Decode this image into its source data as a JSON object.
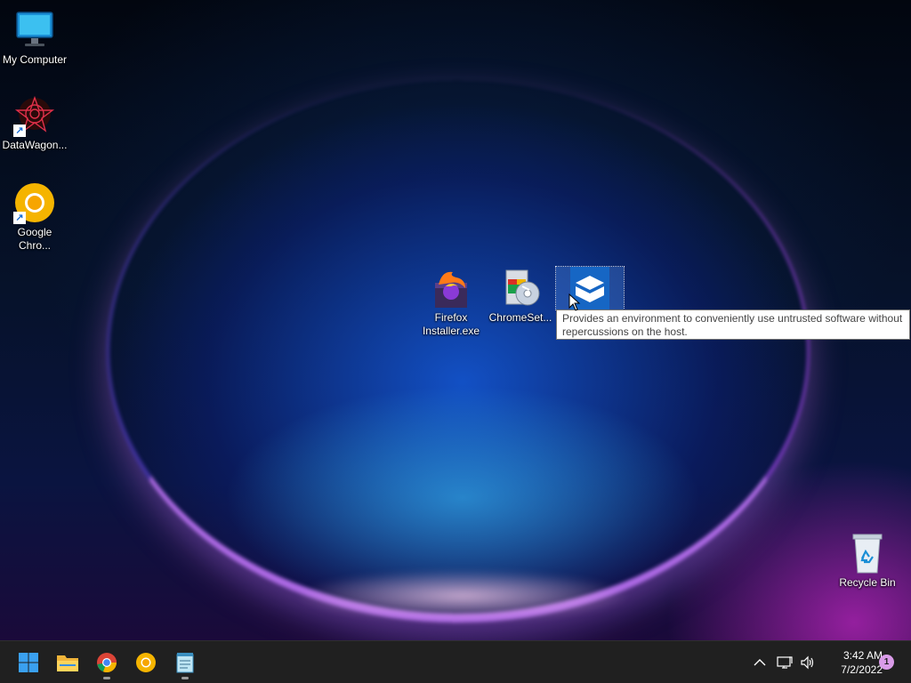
{
  "desktop": {
    "icons": [
      {
        "label": "My Computer",
        "icon": "computer-monitor-icon"
      },
      {
        "label": "DataWagon...",
        "icon": "datawagon-app-icon",
        "shortcut": true
      },
      {
        "label": "Google Chro...",
        "label_line1": "Google",
        "label_line2": "Chro...",
        "icon": "chrome-canary-icon",
        "shortcut": true
      },
      {
        "label": "Firefox Installer.exe",
        "label_line1": "Firefox",
        "label_line2": "Installer.exe",
        "icon": "firefox-installer-icon"
      },
      {
        "label": "ChromeSet...",
        "icon": "chrome-setup-icon"
      },
      {
        "label": "",
        "icon": "sandbox-app-icon",
        "selected": true
      },
      {
        "label": "Recycle Bin",
        "icon": "recycle-bin-icon"
      }
    ],
    "tooltip": {
      "line1": "Provides an environment to conveniently use untrusted software without",
      "line2": "repercussions on the host."
    }
  },
  "taskbar": {
    "pinned": [
      {
        "name": "start",
        "icon": "windows-start-icon"
      },
      {
        "name": "file-explorer",
        "icon": "folder-icon"
      },
      {
        "name": "chrome",
        "icon": "chrome-icon",
        "running": true
      },
      {
        "name": "chrome-canary",
        "icon": "chrome-canary-icon"
      },
      {
        "name": "notepad",
        "icon": "notepad-icon",
        "running": true
      }
    ],
    "tray": {
      "icons": [
        "chevron-up-icon",
        "network-icon",
        "volume-icon"
      ],
      "time": "3:42 AM",
      "date": "7/2/2022",
      "notification_count": "1"
    }
  },
  "colors": {
    "taskbar_bg": "#202020",
    "tooltip_bg": "#ffffff",
    "accent": "#0078d4",
    "notification_badge": "#d99be8"
  }
}
